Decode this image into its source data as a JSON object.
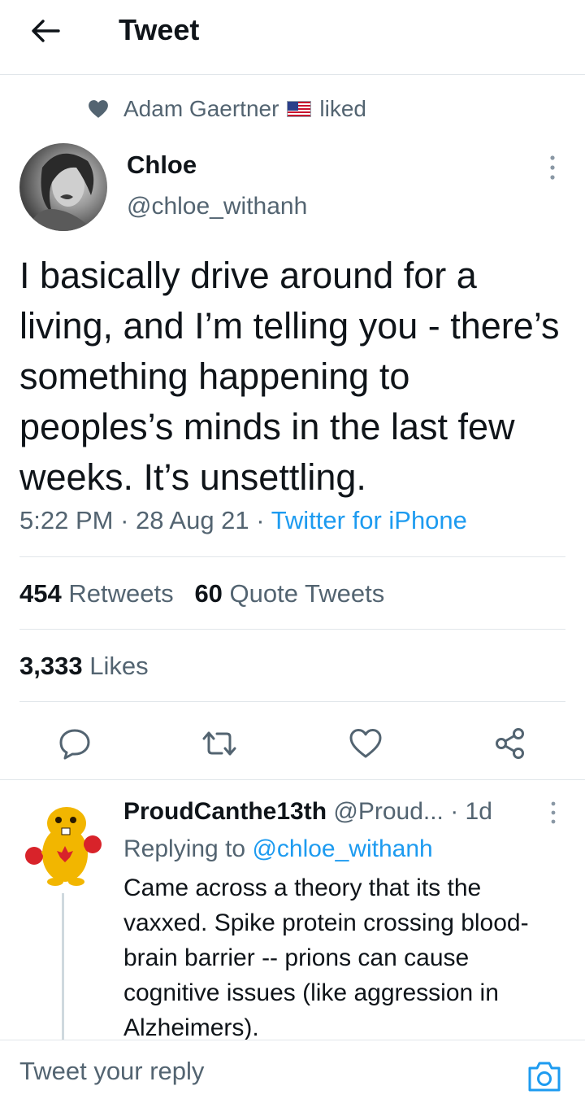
{
  "header": {
    "title": "Tweet"
  },
  "social_context": {
    "user": "Adam Gaertner",
    "action": "liked"
  },
  "tweet": {
    "author_name": "Chloe",
    "author_handle": "@chloe_withanh",
    "text": "I basically drive around for a living, and I’m telling you - there’s something happening to peoples’s minds in the last few weeks.  It’s unsettling.",
    "time": "5:22 PM",
    "date": "28 Aug 21",
    "source": "Twitter for iPhone",
    "separator": "·",
    "retweets_count": "454",
    "retweets_label": "Retweets",
    "quotes_count": "60",
    "quotes_label": "Quote Tweets",
    "likes_count": "3,333",
    "likes_label": "Likes"
  },
  "reply": {
    "author_name": "ProudCanthe13th",
    "author_handle": "@Proud...",
    "age": "· 1d",
    "replying_prefix": "Replying to",
    "replying_to": "@chloe_withanh",
    "text": "Came across a theory that its the vaxxed.  Spike protein crossing blood-brain barrier -- prions can cause cognitive issues (like aggression in Alzheimers)."
  },
  "reply_bar": {
    "placeholder": "Tweet your reply"
  },
  "icons": {
    "back": "arrow-left-icon",
    "like_social": "heart-filled-icon",
    "flag": "us-flag-icon",
    "more": "more-vertical-icon",
    "reply": "comment-icon",
    "retweet": "retweet-icon",
    "like": "heart-icon",
    "share": "share-icon",
    "camera": "camera-icon"
  },
  "colors": {
    "accent": "#1d9bf0",
    "text": "#0f1419",
    "muted": "#536471",
    "divider": "#e1e6ea"
  }
}
